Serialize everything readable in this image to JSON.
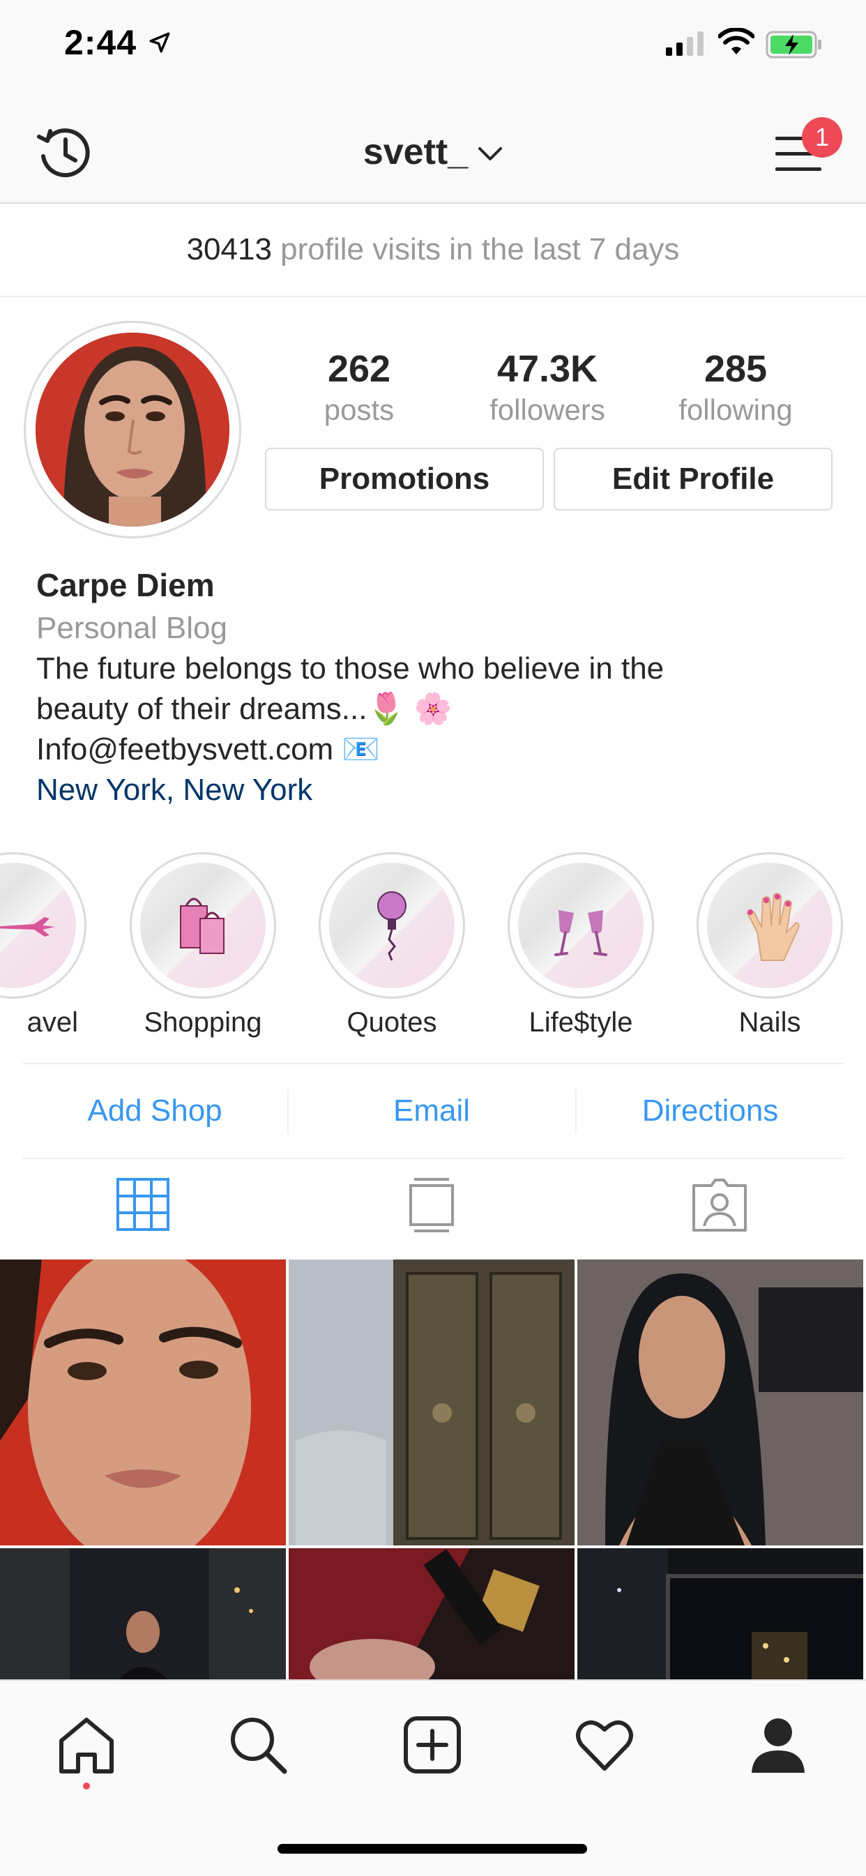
{
  "status_bar": {
    "time": "2:44",
    "battery_charging": true
  },
  "header": {
    "username": "svett_",
    "notification_count": "1"
  },
  "visits": {
    "count": "30413",
    "text": "profile visits in the last 7 days"
  },
  "stats": [
    {
      "value": "262",
      "label": "posts"
    },
    {
      "value": "47.3K",
      "label": "followers"
    },
    {
      "value": "285",
      "label": "following"
    }
  ],
  "buttons": {
    "promotions": "Promotions",
    "edit_profile": "Edit Profile"
  },
  "bio": {
    "name": "Carpe Diem",
    "category": "Personal Blog",
    "line1": "The future belongs to those who believe in the",
    "line2": "beauty of their dreams...🌷 🌸",
    "email": "Info@feetbysvett.com 📧",
    "location": "New York, New York"
  },
  "highlights": [
    {
      "label": "avel",
      "icon": "airplane-icon"
    },
    {
      "label": "Shopping",
      "icon": "shopping-bags-icon"
    },
    {
      "label": "Quotes",
      "icon": "lightbulb-icon"
    },
    {
      "label": "Life$tyle",
      "icon": "champagne-icon"
    },
    {
      "label": "Nails",
      "icon": "hand-icon"
    }
  ],
  "contact": {
    "add_shop": "Add Shop",
    "email": "Email",
    "directions": "Directions"
  },
  "tabs": [
    "grid-icon",
    "feed-icon",
    "tagged-icon"
  ],
  "colors": {
    "accent": "#3897f0",
    "badge": "#ed4956",
    "link": "#003569",
    "muted": "#999999"
  },
  "tab_bar": [
    "home-icon",
    "search-icon",
    "new-post-icon",
    "activity-icon",
    "profile-icon"
  ]
}
